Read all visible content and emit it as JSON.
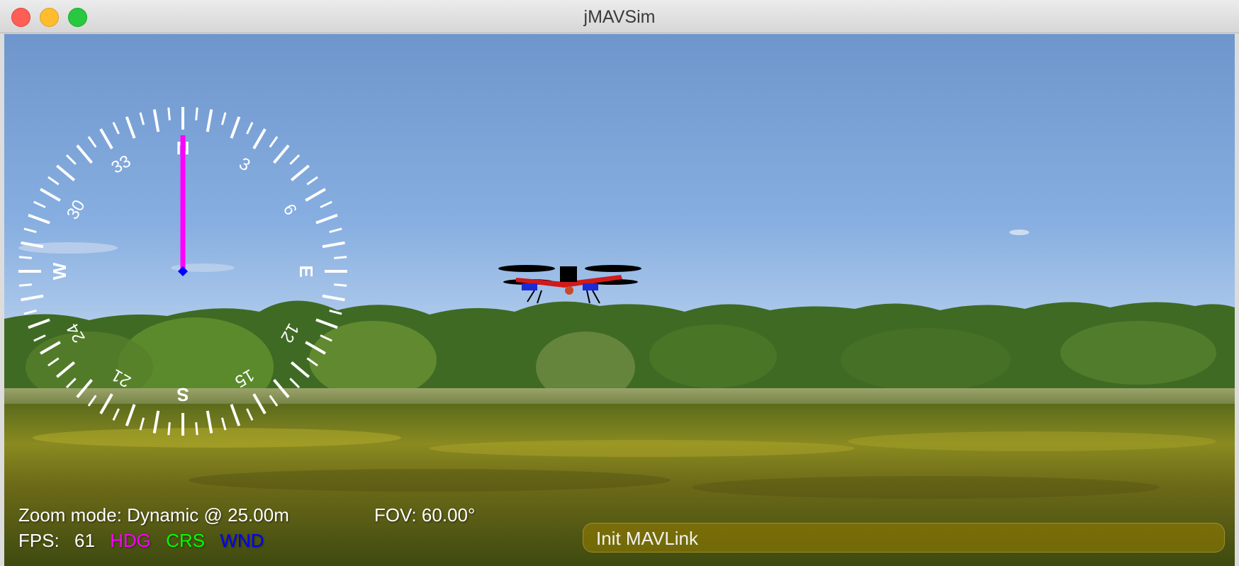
{
  "window": {
    "title": "jMAVSim"
  },
  "compass": {
    "cardinals": [
      "N",
      "E",
      "S",
      "W"
    ],
    "numbers": [
      "3",
      "6",
      "12",
      "15",
      "21",
      "24",
      "30",
      "33"
    ],
    "heading_deg": 0,
    "colors": {
      "hdg": "#ff00ff",
      "crs": "#00ff00",
      "wnd": "#0000ff"
    }
  },
  "hud": {
    "zoom_mode": "Zoom mode: Dynamic @ 25.00m",
    "fov": "FOV: 60.00°",
    "fps_label": "FPS:",
    "fps_value": "61",
    "legend": {
      "hdg": "HDG",
      "crs": "CRS",
      "wnd": "WND"
    }
  },
  "status": {
    "message": "Init MAVLink"
  }
}
